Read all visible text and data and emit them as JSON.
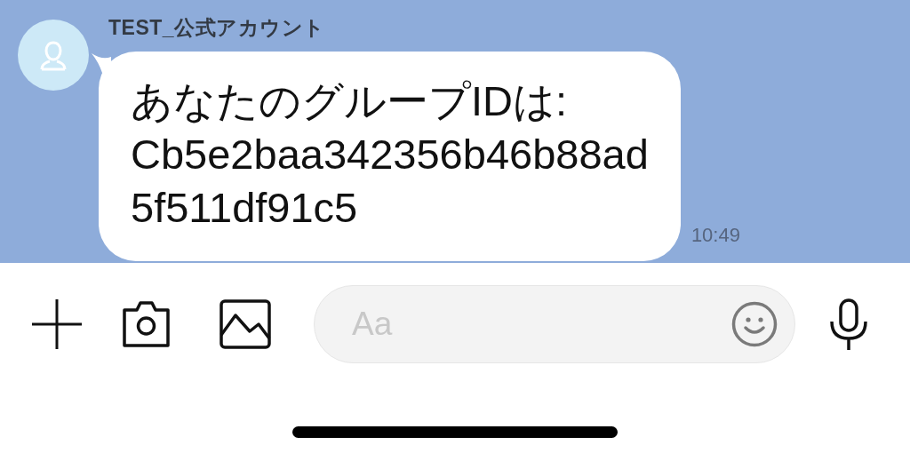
{
  "chat": {
    "sender": "TEST_公式アカウント",
    "message": {
      "text": "あなたのグループIDは:\nCb5e2baa342356b46b88ad\n5f511df91c5",
      "time": "10:49"
    }
  },
  "input_bar": {
    "placeholder": "Aa"
  }
}
